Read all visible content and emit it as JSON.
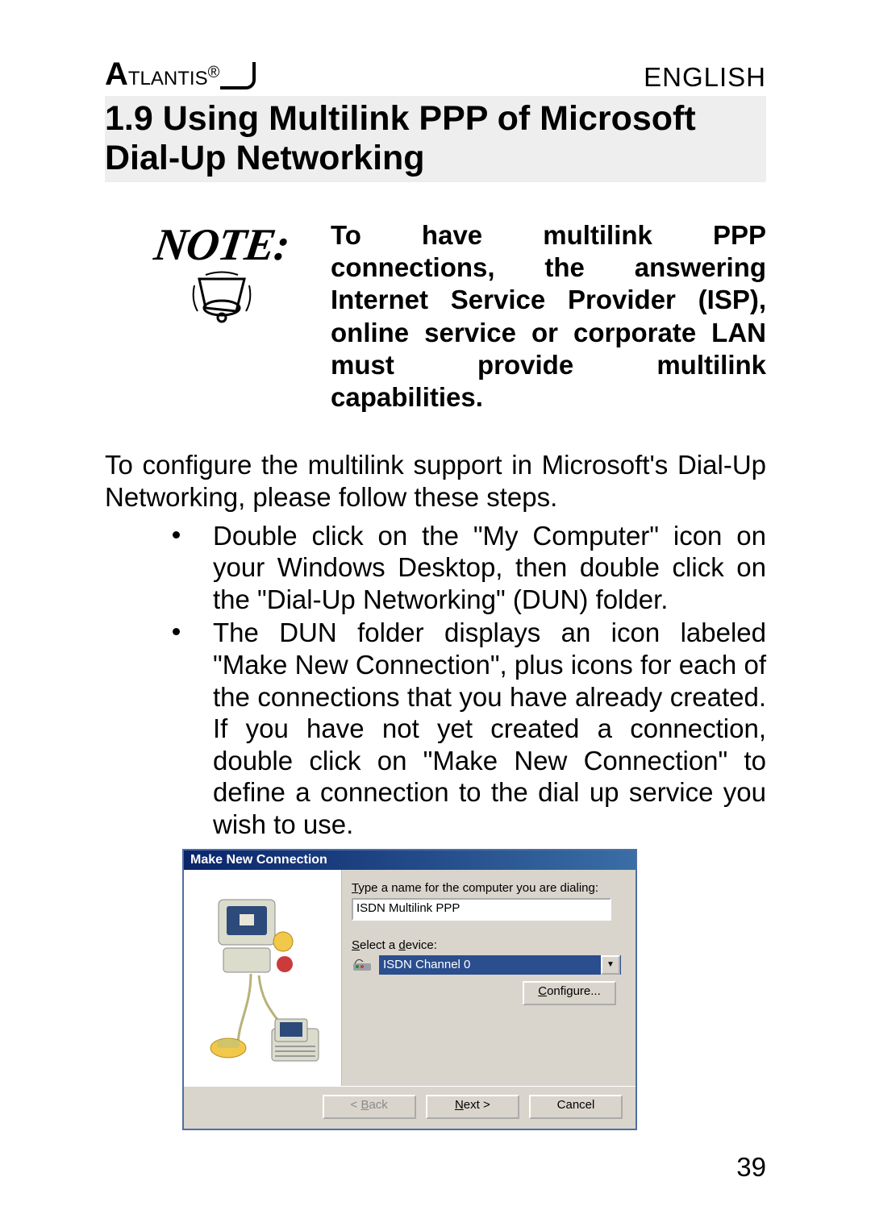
{
  "header": {
    "brand_a": "A",
    "brand_rest": "TLANTIS",
    "brand_reg": "®",
    "language": "ENGLISH"
  },
  "section": {
    "heading": "1.9 Using Multilink PPP of Microsoft Dial-Up Networking"
  },
  "note": {
    "label": "NOTE:",
    "body": "To have multilink PPP connections, the answering Internet Service Provider (ISP), online service or corporate LAN must provide multilink capabilities."
  },
  "paragraph": "To configure the multilink support in Microsoft's Dial-Up Networking, please follow these steps.",
  "bullets": [
    "Double click on the \"My Computer\" icon on your Windows Desktop, then double click on the \"Dial-Up Networking\" (DUN) folder.",
    "The DUN folder displays an icon labeled \"Make New Connection\", plus icons for each of the connections that you have already created.  If you have not yet created a connection, double click on \"Make New Connection\" to define a connection to the dial up service you wish to use."
  ],
  "dialog": {
    "title": "Make New Connection",
    "name_label": "Type a name for the computer you are dialing:",
    "name_value": "ISDN Multilink PPP",
    "device_label": "Select a device:",
    "device_value": "ISDN Channel 0",
    "configure_label": "Configure...",
    "back_label": "< Back",
    "next_label": "Next >",
    "cancel_label": "Cancel"
  },
  "page_number": "39"
}
